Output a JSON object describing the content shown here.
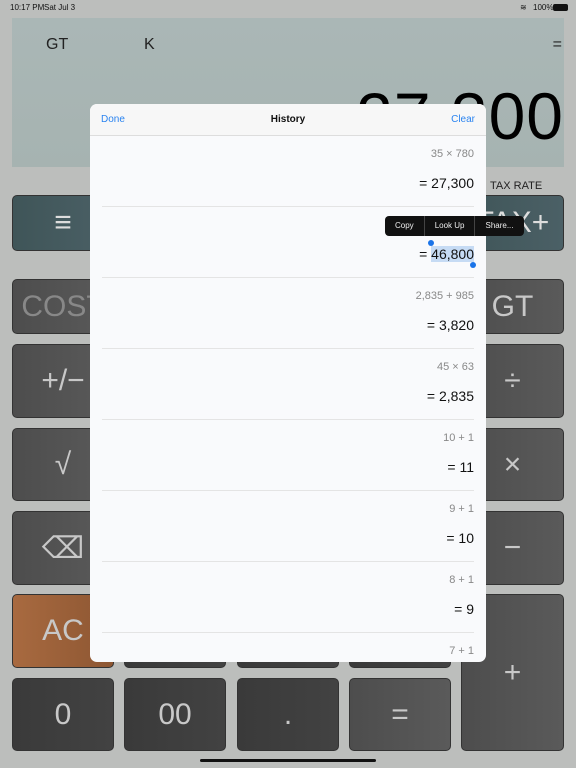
{
  "status": {
    "time": "10:17 PM",
    "date": "Sat Jul 3",
    "battery": "100%"
  },
  "display": {
    "gt": "GT",
    "k": "K",
    "eq": "=",
    "value": "27,300",
    "tax_rate": "TAX RATE"
  },
  "keys": {
    "menu": "≡",
    "tax_plus": "TAX+",
    "cost": "COST",
    "gt": "GT",
    "sign": "+/−",
    "divide": "÷",
    "sqrt": "√",
    "multiply": "×",
    "backspace": "⌫",
    "minus": "−",
    "ac": "AC",
    "plus": "+",
    "zero": "0",
    "double_zero": "00",
    "dot": ".",
    "equals": "="
  },
  "history": {
    "done": "Done",
    "title": "History",
    "clear": "Clear",
    "rows": [
      {
        "expr": "35 × 780",
        "result": "= 27,300"
      },
      {
        "expr": "",
        "result": "46,800",
        "prefix": "= "
      },
      {
        "expr": "2,835 + 985",
        "result": "= 3,820"
      },
      {
        "expr": "45 × 63",
        "result": "= 2,835"
      },
      {
        "expr": "10 + 1",
        "result": "= 11"
      },
      {
        "expr": "9 + 1",
        "result": "= 10"
      },
      {
        "expr": "8 + 1",
        "result": "= 9"
      },
      {
        "expr": "7 + 1",
        "result": ""
      }
    ]
  },
  "context_menu": {
    "copy": "Copy",
    "look_up": "Look Up",
    "share": "Share..."
  }
}
